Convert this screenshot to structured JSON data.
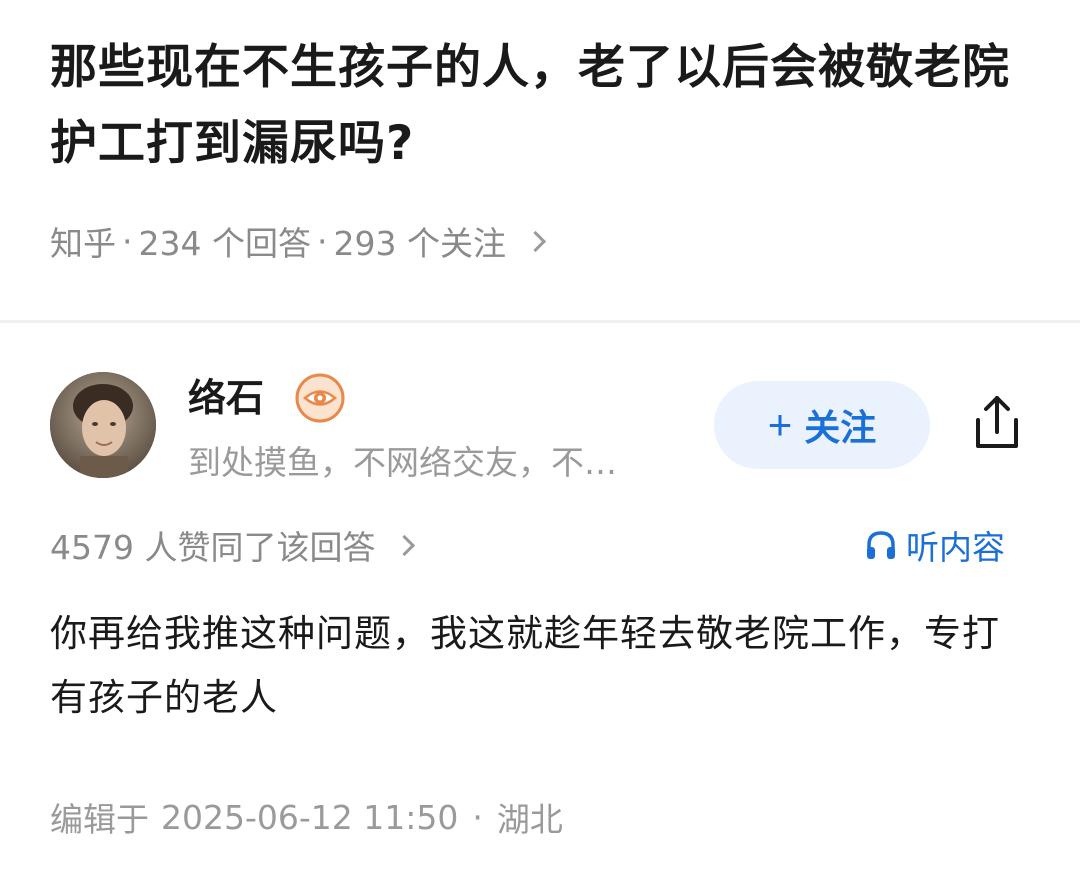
{
  "question": {
    "title": "那些现在不生孩子的人，老了以后会被敬老院护工打到漏尿吗?",
    "source": "知乎",
    "answer_count": "234 个回答",
    "follow_count": "293 个关注",
    "separator": "·"
  },
  "answer": {
    "author_name": "络石",
    "author_bio": "到处摸鱼，不网络交友，不…",
    "follow_button": {
      "icon": "+",
      "label": "关注"
    },
    "votes_text": "4579 人赞同了该回答",
    "listen_label": "听内容",
    "content": "你再给我推这种问题，我这就趁年轻去敬老院工作，专打有孩子的老人",
    "edit_prefix": "编辑于",
    "edit_time": "2025-06-12 11:50",
    "edit_separator": "·",
    "location": "湖北"
  },
  "colors": {
    "accent": "#1a6fd8",
    "follow_bg": "#eaf2fd",
    "meta_gray": "#8a8a8a",
    "badge_orange": "#e8894a"
  },
  "icons": {
    "share": "share-icon",
    "headphones": "headphones-icon",
    "badge": "eye-badge-icon",
    "chevron": "chevron-right-icon"
  }
}
